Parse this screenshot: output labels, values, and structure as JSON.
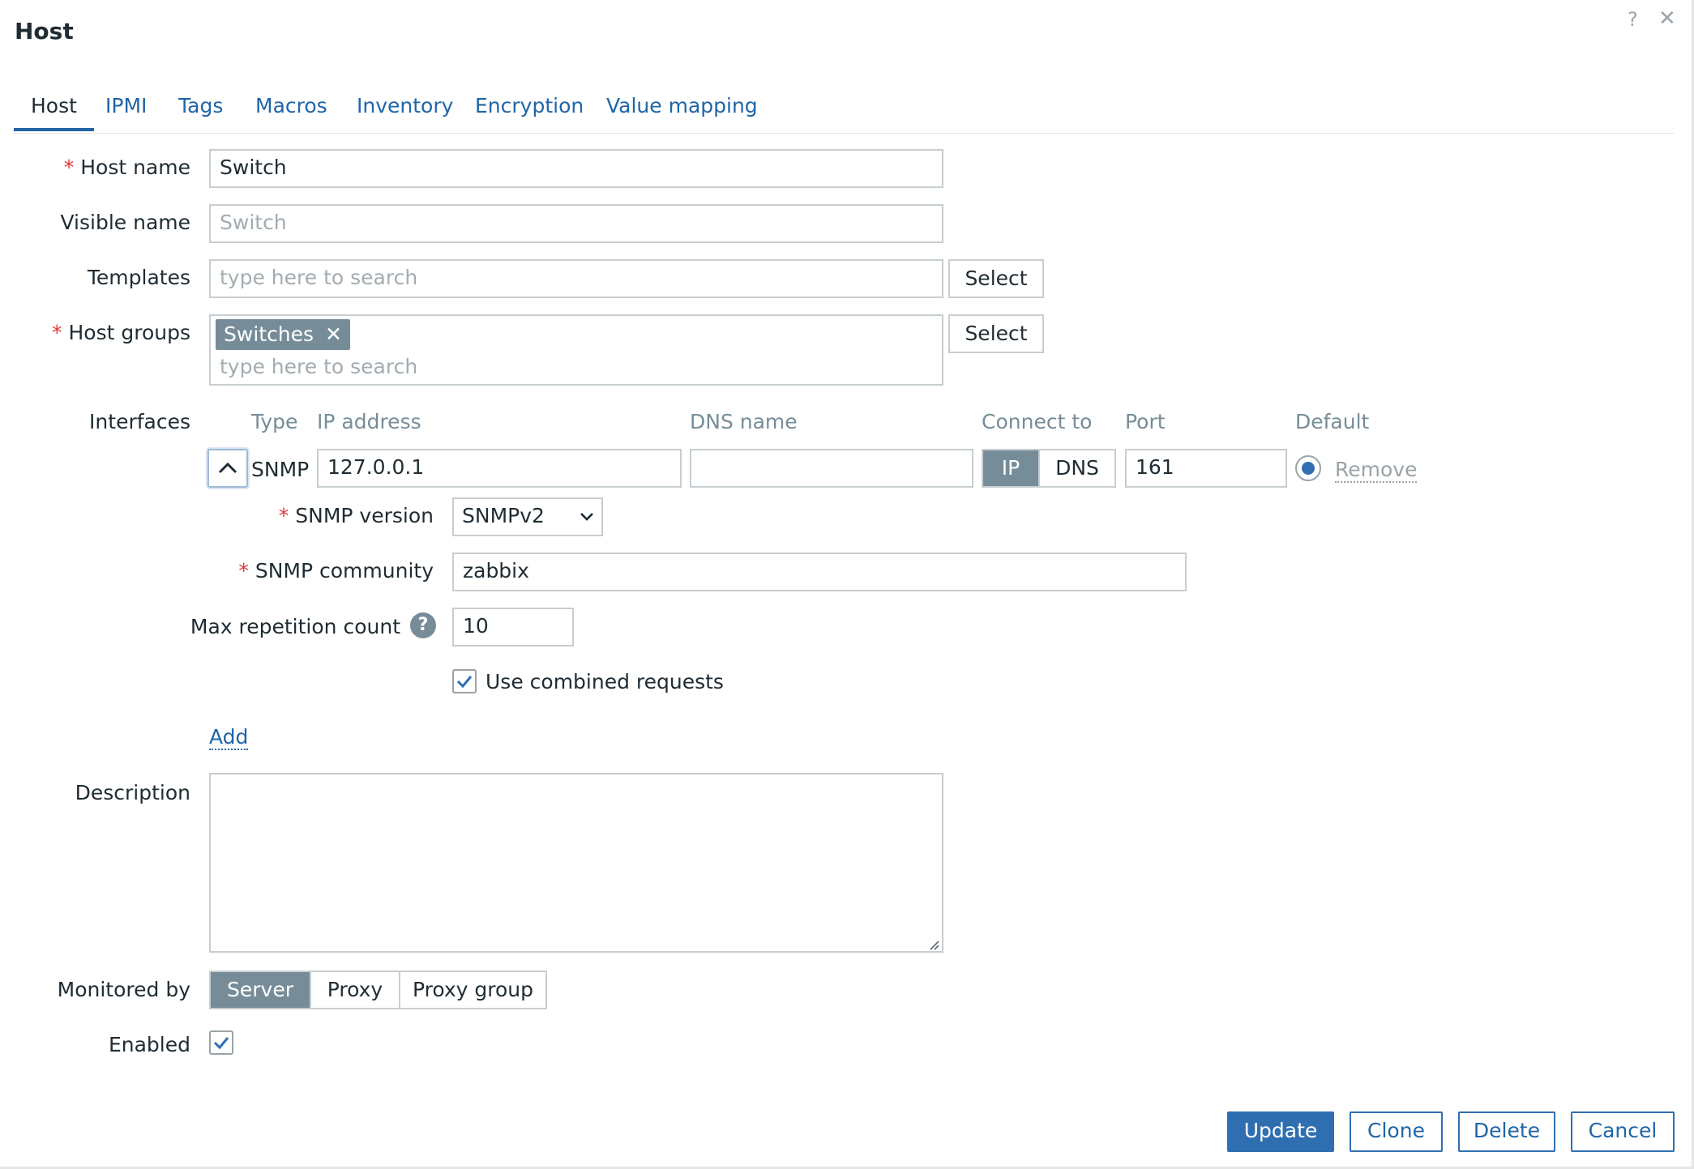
{
  "dialog": {
    "title": "Host",
    "help_icon": "?",
    "close_icon": "✕"
  },
  "tabs": [
    {
      "label": "Host"
    },
    {
      "label": "IPMI"
    },
    {
      "label": "Tags"
    },
    {
      "label": "Macros"
    },
    {
      "label": "Inventory"
    },
    {
      "label": "Encryption"
    },
    {
      "label": "Value mapping"
    }
  ],
  "form": {
    "host_name": {
      "label": "Host name",
      "value": "Switch"
    },
    "visible_name": {
      "label": "Visible name",
      "placeholder": "Switch"
    },
    "templates": {
      "label": "Templates",
      "placeholder": "type here to search",
      "select_label": "Select"
    },
    "host_groups": {
      "label": "Host groups",
      "tag": "Switches",
      "tag_remove": "✕",
      "placeholder": "type here to search",
      "select_label": "Select"
    },
    "interfaces": {
      "label": "Interfaces",
      "headers": {
        "type": "Type",
        "ip": "IP address",
        "dns": "DNS name",
        "connect_to": "Connect to",
        "port": "Port",
        "default": "Default"
      },
      "row": {
        "type": "SNMP",
        "ip": "127.0.0.1",
        "dns": "",
        "connect_options": [
          "IP",
          "DNS"
        ],
        "connect_selected": "IP",
        "port": "161",
        "remove_label": "Remove"
      },
      "snmp": {
        "version_label": "SNMP version",
        "version_value": "SNMPv2",
        "community_label": "SNMP community",
        "community_value": "zabbix",
        "max_rep_label": "Max repetition count",
        "max_rep_value": "10",
        "combined_label": "Use combined requests",
        "combined_checked": true
      },
      "add_label": "Add"
    },
    "description": {
      "label": "Description",
      "value": ""
    },
    "monitored_by": {
      "label": "Monitored by",
      "options": [
        "Server",
        "Proxy",
        "Proxy group"
      ],
      "selected": "Server"
    },
    "enabled": {
      "label": "Enabled",
      "checked": true
    }
  },
  "footer": {
    "update": "Update",
    "clone": "Clone",
    "delete": "Delete",
    "cancel": "Cancel"
  },
  "colors": {
    "accent": "#2f6fb1",
    "link": "#1f65a8",
    "required": "#e33734",
    "segment_on": "#768d99"
  }
}
